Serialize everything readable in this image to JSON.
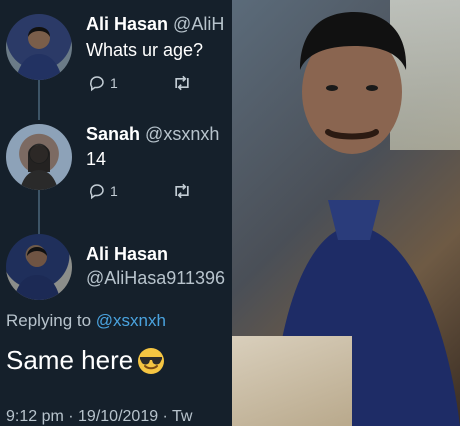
{
  "tweets": [
    {
      "name": "Ali Hasan",
      "handle": "@AliH",
      "text": "Whats ur age?",
      "replies": "1"
    },
    {
      "name": "Sanah",
      "handle": "@xsxnxh",
      "text": "14",
      "replies": "1"
    }
  ],
  "reply": {
    "name": "Ali Hasan",
    "handle": "@AliHasa911396",
    "replying_prefix": "Replying to",
    "replying_to": "@xsxnxh",
    "text": "Same here",
    "meta": "9:12 pm · 19/10/2019 · Tw"
  },
  "colors": {
    "bg": "#15202b",
    "link": "#4aa3df",
    "muted": "#b7c3cc"
  },
  "icons": [
    "reply-icon",
    "retweet-icon",
    "sunglasses-emoji-icon"
  ]
}
